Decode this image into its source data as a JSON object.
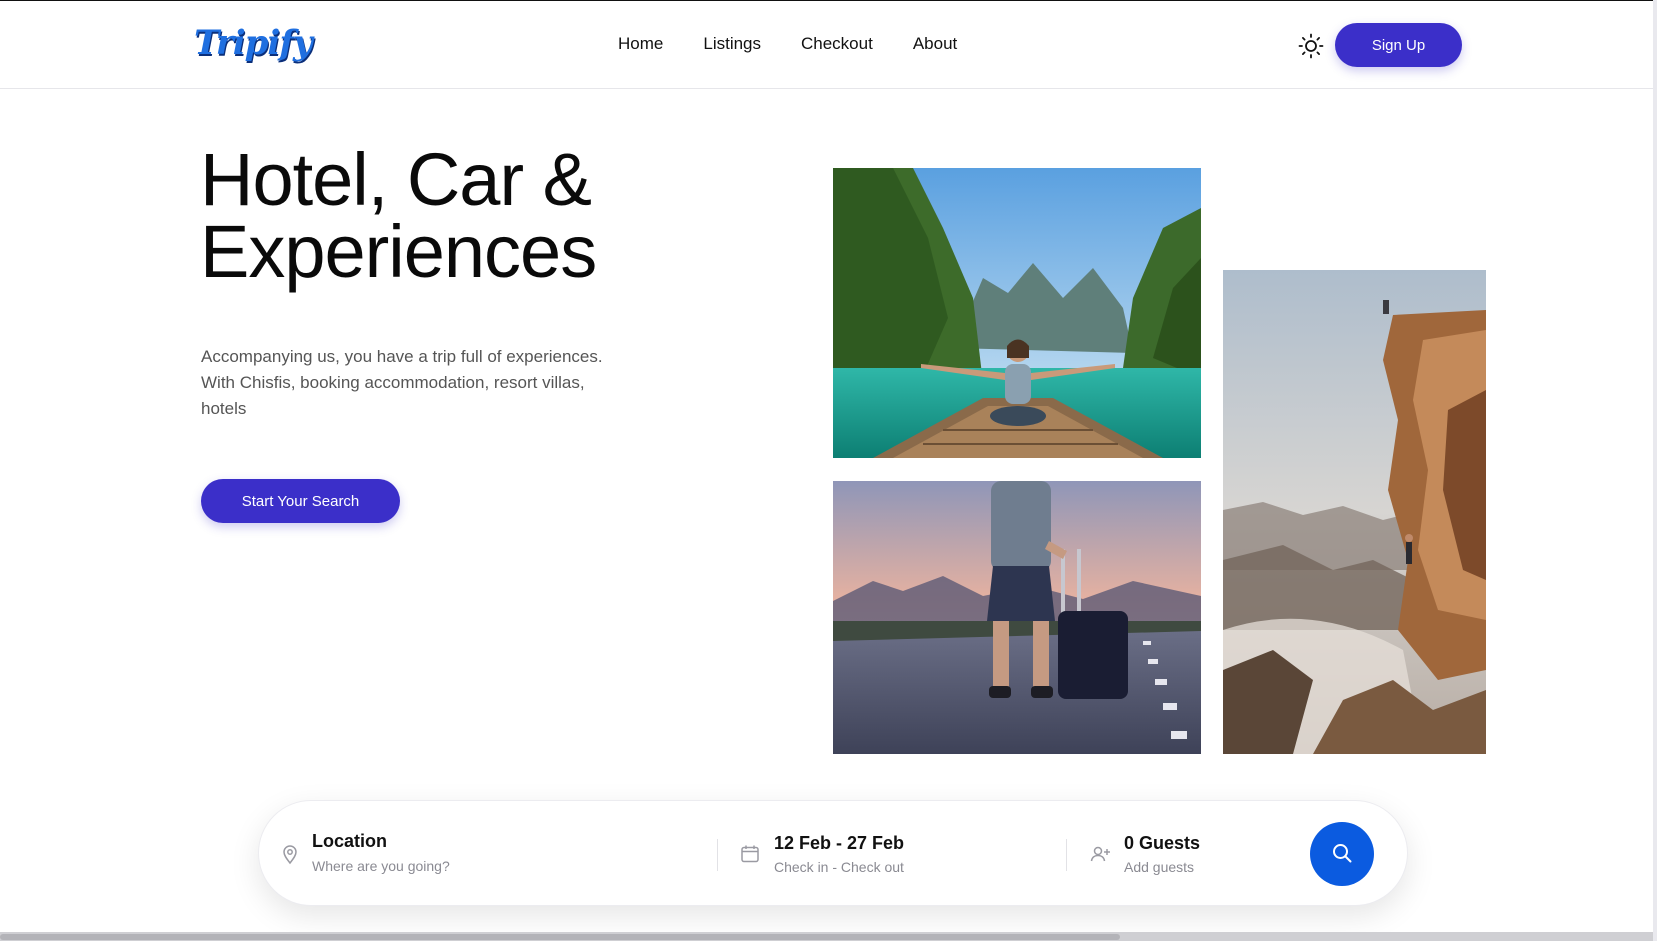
{
  "brand": {
    "logo_text": "Tripify",
    "accent": "#3b2fc9",
    "logo_color": "#1f6fe0",
    "search_button_color": "#0b5be0"
  },
  "nav": {
    "items": [
      {
        "label": "Home"
      },
      {
        "label": "Listings"
      },
      {
        "label": "Checkout"
      },
      {
        "label": "About"
      }
    ],
    "theme_icon": "sun-icon",
    "signup_label": "Sign Up"
  },
  "hero": {
    "title_line1": "Hotel, Car &",
    "title_line2": "Experiences",
    "description": "Accompanying us, you have a trip full of experiences. With Chisfis, booking accommodation, resort villas, hotels",
    "cta_label": "Start Your Search"
  },
  "gallery": {
    "images": [
      {
        "icon": "boat-travel-photo"
      },
      {
        "icon": "road-suitcase-photo"
      },
      {
        "icon": "cliff-canyon-photo"
      }
    ]
  },
  "search": {
    "location": {
      "title": "Location",
      "placeholder": "Where are you going?",
      "icon": "map-pin-icon"
    },
    "dates": {
      "title": "12 Feb - 27 Feb",
      "subtitle": "Check in - Check out",
      "icon": "calendar-icon"
    },
    "guests": {
      "title": "0 Guests",
      "subtitle": "Add guests",
      "icon": "add-user-icon"
    },
    "submit_icon": "search-icon"
  }
}
